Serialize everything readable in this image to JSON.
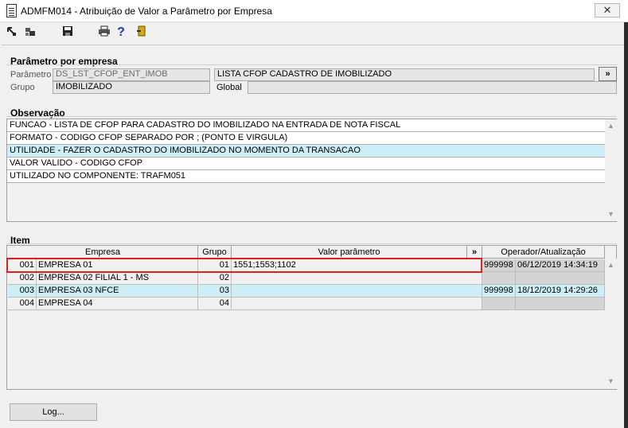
{
  "window": {
    "title": "ADMFM014 - Atribuição de Valor a Parâmetro por Empresa",
    "close_label": "✕"
  },
  "toolbar": {
    "icons": [
      "arrow-icon",
      "grid-icon",
      "save-icon",
      "print-icon",
      "help-icon",
      "exit-icon"
    ]
  },
  "param": {
    "section_title": "Parâmetro por empresa",
    "parametro_label": "Parâmetro",
    "parametro_value": "DS_LST_CFOP_ENT_IMOB",
    "description": "LISTA CFOP CADASTRO DE IMOBILIZADO",
    "expand_label": "»",
    "grupo_label": "Grupo",
    "grupo_value": "IMOBILIZADO",
    "global_label": "Global",
    "global_value": ""
  },
  "observacao": {
    "section_title": "Observação",
    "lines": [
      "FUNCAO - LISTA DE CFOP PARA CADASTRO DO IMOBILIZADO NA ENTRADA DE NOTA FISCAL",
      "FORMATO - CODIGO CFOP SEPARADO POR ; (PONTO E VIRGULA)",
      "UTILIDADE - FAZER O CADASTRO DO IMOBILIZADO NO MOMENTO DA TRANSACAO",
      "VALOR VALIDO - CODIGO CFOP",
      "UTILIZADO NO COMPONENTE: TRAFM051"
    ]
  },
  "item": {
    "section_title": "Item",
    "headers": {
      "empresa": "Empresa",
      "grupo": "Grupo",
      "valor": "Valor parâmetro",
      "expand": "»",
      "operador": "Operador/Atualização"
    },
    "rows": [
      {
        "code": "001",
        "name": "EMPRESA 01",
        "grupo": "01",
        "valor": "1551;1553;1102",
        "operador": "999998",
        "data": "06/12/2019 14:34:19"
      },
      {
        "code": "002",
        "name": "EMPRESA 02 FILIAL 1 - MS",
        "grupo": "02",
        "valor": "",
        "operador": "",
        "data": ""
      },
      {
        "code": "003",
        "name": "EMPRESA 03 NFCE",
        "grupo": "03",
        "valor": "",
        "operador": "999998",
        "data": "18/12/2019 14:29:26"
      },
      {
        "code": "004",
        "name": "EMPRESA 04",
        "grupo": "04",
        "valor": "",
        "operador": "",
        "data": ""
      }
    ]
  },
  "footer": {
    "log_button": "Log..."
  }
}
